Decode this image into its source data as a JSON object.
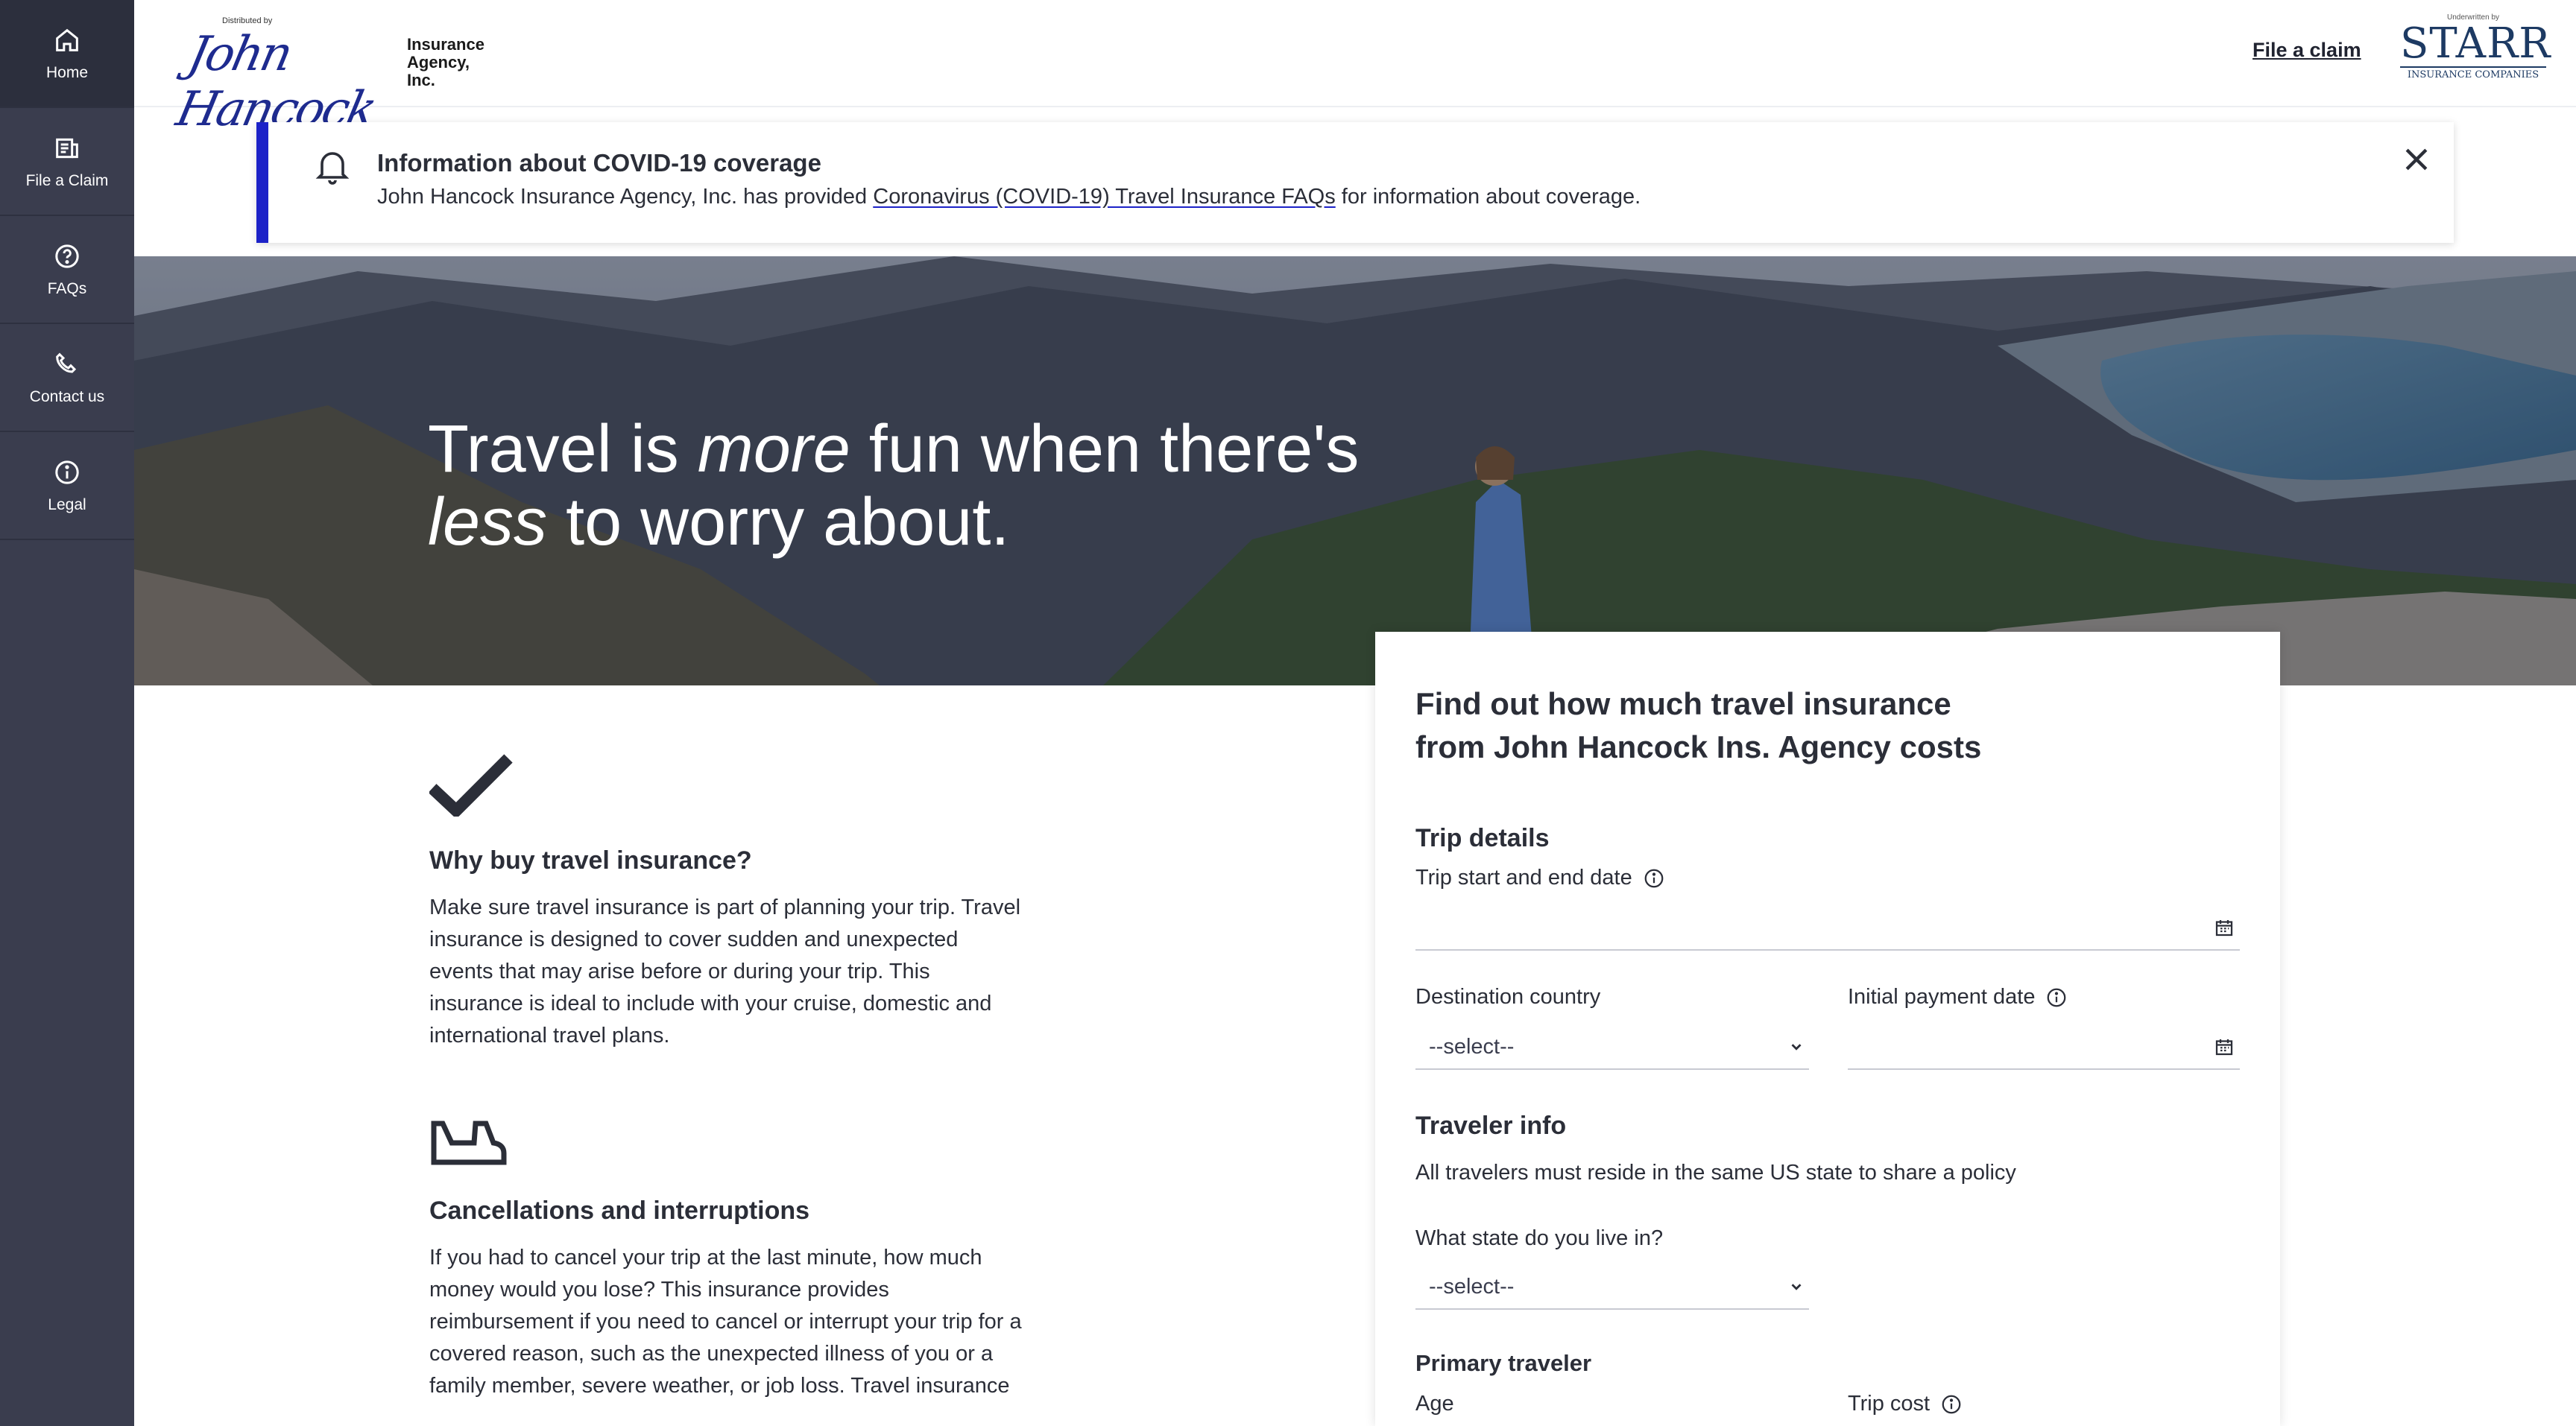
{
  "sidebar": {
    "items": [
      {
        "label": "Home",
        "icon": "home-icon"
      },
      {
        "label": "File a Claim",
        "icon": "claim-document-icon"
      },
      {
        "label": "FAQs",
        "icon": "question-icon"
      },
      {
        "label": "Contact us",
        "icon": "phone-icon"
      },
      {
        "label": "Legal",
        "icon": "info-icon"
      }
    ]
  },
  "header": {
    "distributed_by": "Distributed by",
    "jh_logo_text": "John Hancock",
    "agency_line1": "Insurance",
    "agency_line2": "Agency, Inc.",
    "file_claim": "File a claim",
    "underwritten_by": "Underwritten by",
    "starr_name": "STARR",
    "starr_sub": "INSURANCE COMPANIES"
  },
  "alert": {
    "title": "Information about COVID-19 coverage",
    "body_before": "John Hancock Insurance Agency, Inc. has provided ",
    "link": "Coronavirus (COVID-19) Travel Insurance FAQs",
    "body_after": " for information about coverage."
  },
  "hero": {
    "line1_a": "Travel is ",
    "line1_em": "more",
    "line1_b": " fun when there's",
    "line2_em": "less",
    "line2_b": " to worry about."
  },
  "features": [
    {
      "title": "Why buy travel insurance?",
      "text": "Make sure travel insurance is part of planning your trip. Travel insurance is designed to cover sudden and unexpected events that may arise before or during your trip. This insurance is ideal to include with your cruise, domestic and international travel plans."
    },
    {
      "title": "Cancellations and interruptions",
      "text": "If you had to cancel your trip at the last minute, how much money would you lose? This insurance provides reimbursement if you need to cancel or interrupt your trip for a covered reason, such as the unexpected illness of you or a family member, severe weather, or job loss. Travel insurance"
    }
  ],
  "quote": {
    "title_line1": "Find out how much travel insurance",
    "title_line2": "from John Hancock Ins. Agency costs",
    "trip_details": "Trip details",
    "trip_dates_label": "Trip start and end date",
    "destination_label": "Destination country",
    "destination_value": "--select--",
    "payment_date_label": "Initial payment date",
    "traveler_info": "Traveler info",
    "traveler_note": "All travelers must reside in the same US state to share a policy",
    "state_label": "What state do you live in?",
    "state_value": "--select--",
    "primary_traveler": "Primary traveler",
    "age_label": "Age",
    "trip_cost_label": "Trip cost"
  },
  "colors": {
    "sidebar": "#3a3d4e",
    "alert_accent": "#1c22c8",
    "jh_blue": "#1e2b8f",
    "starr_navy": "#1d3a63"
  }
}
